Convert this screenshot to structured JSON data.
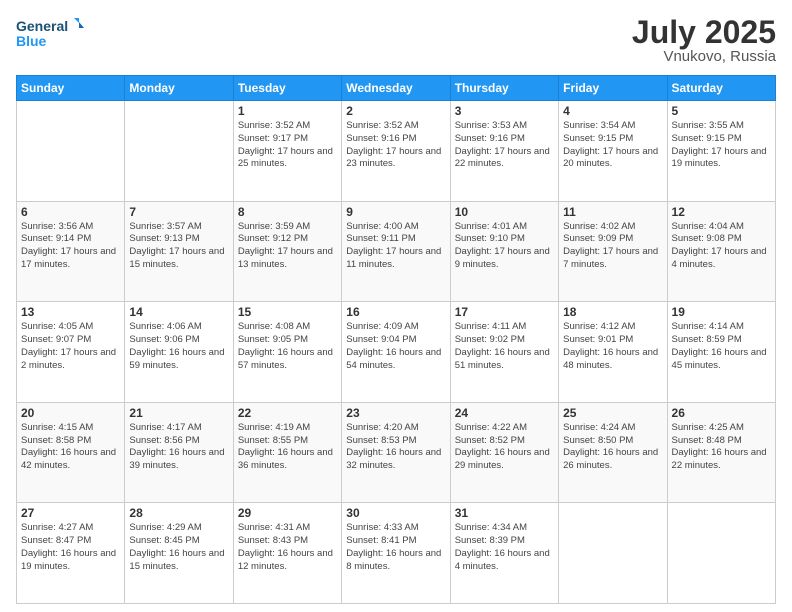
{
  "header": {
    "logo_general": "General",
    "logo_blue": "Blue",
    "month_title": "July 2025",
    "location": "Vnukovo, Russia"
  },
  "days_of_week": [
    "Sunday",
    "Monday",
    "Tuesday",
    "Wednesday",
    "Thursday",
    "Friday",
    "Saturday"
  ],
  "weeks": [
    [
      {
        "day": "",
        "info": ""
      },
      {
        "day": "",
        "info": ""
      },
      {
        "day": "1",
        "info": "Sunrise: 3:52 AM\nSunset: 9:17 PM\nDaylight: 17 hours and 25 minutes."
      },
      {
        "day": "2",
        "info": "Sunrise: 3:52 AM\nSunset: 9:16 PM\nDaylight: 17 hours and 23 minutes."
      },
      {
        "day": "3",
        "info": "Sunrise: 3:53 AM\nSunset: 9:16 PM\nDaylight: 17 hours and 22 minutes."
      },
      {
        "day": "4",
        "info": "Sunrise: 3:54 AM\nSunset: 9:15 PM\nDaylight: 17 hours and 20 minutes."
      },
      {
        "day": "5",
        "info": "Sunrise: 3:55 AM\nSunset: 9:15 PM\nDaylight: 17 hours and 19 minutes."
      }
    ],
    [
      {
        "day": "6",
        "info": "Sunrise: 3:56 AM\nSunset: 9:14 PM\nDaylight: 17 hours and 17 minutes."
      },
      {
        "day": "7",
        "info": "Sunrise: 3:57 AM\nSunset: 9:13 PM\nDaylight: 17 hours and 15 minutes."
      },
      {
        "day": "8",
        "info": "Sunrise: 3:59 AM\nSunset: 9:12 PM\nDaylight: 17 hours and 13 minutes."
      },
      {
        "day": "9",
        "info": "Sunrise: 4:00 AM\nSunset: 9:11 PM\nDaylight: 17 hours and 11 minutes."
      },
      {
        "day": "10",
        "info": "Sunrise: 4:01 AM\nSunset: 9:10 PM\nDaylight: 17 hours and 9 minutes."
      },
      {
        "day": "11",
        "info": "Sunrise: 4:02 AM\nSunset: 9:09 PM\nDaylight: 17 hours and 7 minutes."
      },
      {
        "day": "12",
        "info": "Sunrise: 4:04 AM\nSunset: 9:08 PM\nDaylight: 17 hours and 4 minutes."
      }
    ],
    [
      {
        "day": "13",
        "info": "Sunrise: 4:05 AM\nSunset: 9:07 PM\nDaylight: 17 hours and 2 minutes."
      },
      {
        "day": "14",
        "info": "Sunrise: 4:06 AM\nSunset: 9:06 PM\nDaylight: 16 hours and 59 minutes."
      },
      {
        "day": "15",
        "info": "Sunrise: 4:08 AM\nSunset: 9:05 PM\nDaylight: 16 hours and 57 minutes."
      },
      {
        "day": "16",
        "info": "Sunrise: 4:09 AM\nSunset: 9:04 PM\nDaylight: 16 hours and 54 minutes."
      },
      {
        "day": "17",
        "info": "Sunrise: 4:11 AM\nSunset: 9:02 PM\nDaylight: 16 hours and 51 minutes."
      },
      {
        "day": "18",
        "info": "Sunrise: 4:12 AM\nSunset: 9:01 PM\nDaylight: 16 hours and 48 minutes."
      },
      {
        "day": "19",
        "info": "Sunrise: 4:14 AM\nSunset: 8:59 PM\nDaylight: 16 hours and 45 minutes."
      }
    ],
    [
      {
        "day": "20",
        "info": "Sunrise: 4:15 AM\nSunset: 8:58 PM\nDaylight: 16 hours and 42 minutes."
      },
      {
        "day": "21",
        "info": "Sunrise: 4:17 AM\nSunset: 8:56 PM\nDaylight: 16 hours and 39 minutes."
      },
      {
        "day": "22",
        "info": "Sunrise: 4:19 AM\nSunset: 8:55 PM\nDaylight: 16 hours and 36 minutes."
      },
      {
        "day": "23",
        "info": "Sunrise: 4:20 AM\nSunset: 8:53 PM\nDaylight: 16 hours and 32 minutes."
      },
      {
        "day": "24",
        "info": "Sunrise: 4:22 AM\nSunset: 8:52 PM\nDaylight: 16 hours and 29 minutes."
      },
      {
        "day": "25",
        "info": "Sunrise: 4:24 AM\nSunset: 8:50 PM\nDaylight: 16 hours and 26 minutes."
      },
      {
        "day": "26",
        "info": "Sunrise: 4:25 AM\nSunset: 8:48 PM\nDaylight: 16 hours and 22 minutes."
      }
    ],
    [
      {
        "day": "27",
        "info": "Sunrise: 4:27 AM\nSunset: 8:47 PM\nDaylight: 16 hours and 19 minutes."
      },
      {
        "day": "28",
        "info": "Sunrise: 4:29 AM\nSunset: 8:45 PM\nDaylight: 16 hours and 15 minutes."
      },
      {
        "day": "29",
        "info": "Sunrise: 4:31 AM\nSunset: 8:43 PM\nDaylight: 16 hours and 12 minutes."
      },
      {
        "day": "30",
        "info": "Sunrise: 4:33 AM\nSunset: 8:41 PM\nDaylight: 16 hours and 8 minutes."
      },
      {
        "day": "31",
        "info": "Sunrise: 4:34 AM\nSunset: 8:39 PM\nDaylight: 16 hours and 4 minutes."
      },
      {
        "day": "",
        "info": ""
      },
      {
        "day": "",
        "info": ""
      }
    ]
  ]
}
